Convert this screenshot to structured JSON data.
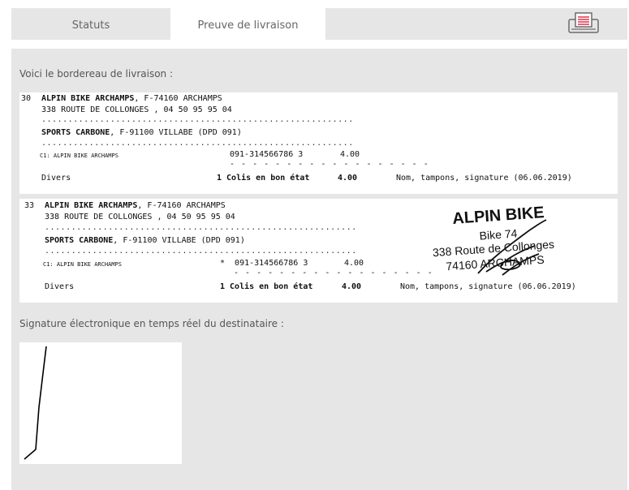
{
  "tabs": [
    {
      "label": "Statuts"
    },
    {
      "label": "Preuve de livraison"
    }
  ],
  "print_icon": "printer-icon",
  "intro_text": "Voici le bordereau de livraison :",
  "slips": [
    {
      "number": "30",
      "sender_name": "ALPIN BIKE ARCHAMPS",
      "sender_city": ", F-74160 ARCHAMPS",
      "sender_address": "338 ROUTE DE COLLONGES , 04 50 95 95 04",
      "recipient_name": "SPORTS CARBONE",
      "recipient_city": ", F-91100 VILLABE (DPD 091)",
      "ref": "C1: ALPIN BIKE ARCHAMPS",
      "tracking": "091-314566786 3",
      "weight": "4.00",
      "category": "Divers",
      "parcels": "1 Colis en bon état",
      "total": "4.00",
      "signature_note": "Nom, tampons, signature (06.06.2019)"
    },
    {
      "number": "33",
      "sender_name": "ALPIN BIKE ARCHAMPS",
      "sender_city": ", F-74160 ARCHAMPS",
      "sender_address": "338 ROUTE DE COLLONGES , 04 50 95 95 04",
      "recipient_name": "SPORTS CARBONE",
      "recipient_city": ", F-91100 VILLABE (DPD 091)",
      "ref": "C1: ALPIN BIKE ARCHAMPS",
      "tracking": "*  091-314566786 3",
      "weight": "4.00",
      "category": "Divers",
      "parcels": "1 Colis en bon état",
      "total": "4.00",
      "signature_note": "Nom, tampons, signature (06.06.2019)"
    }
  ],
  "stamp": {
    "line1": "ALPIN BIKE",
    "line2": "Bike 74",
    "line3": "338 Route de Collonges",
    "line4": "74160 ARCHAMPS"
  },
  "signature_label": "Signature électronique en temps réel du destinataire :"
}
